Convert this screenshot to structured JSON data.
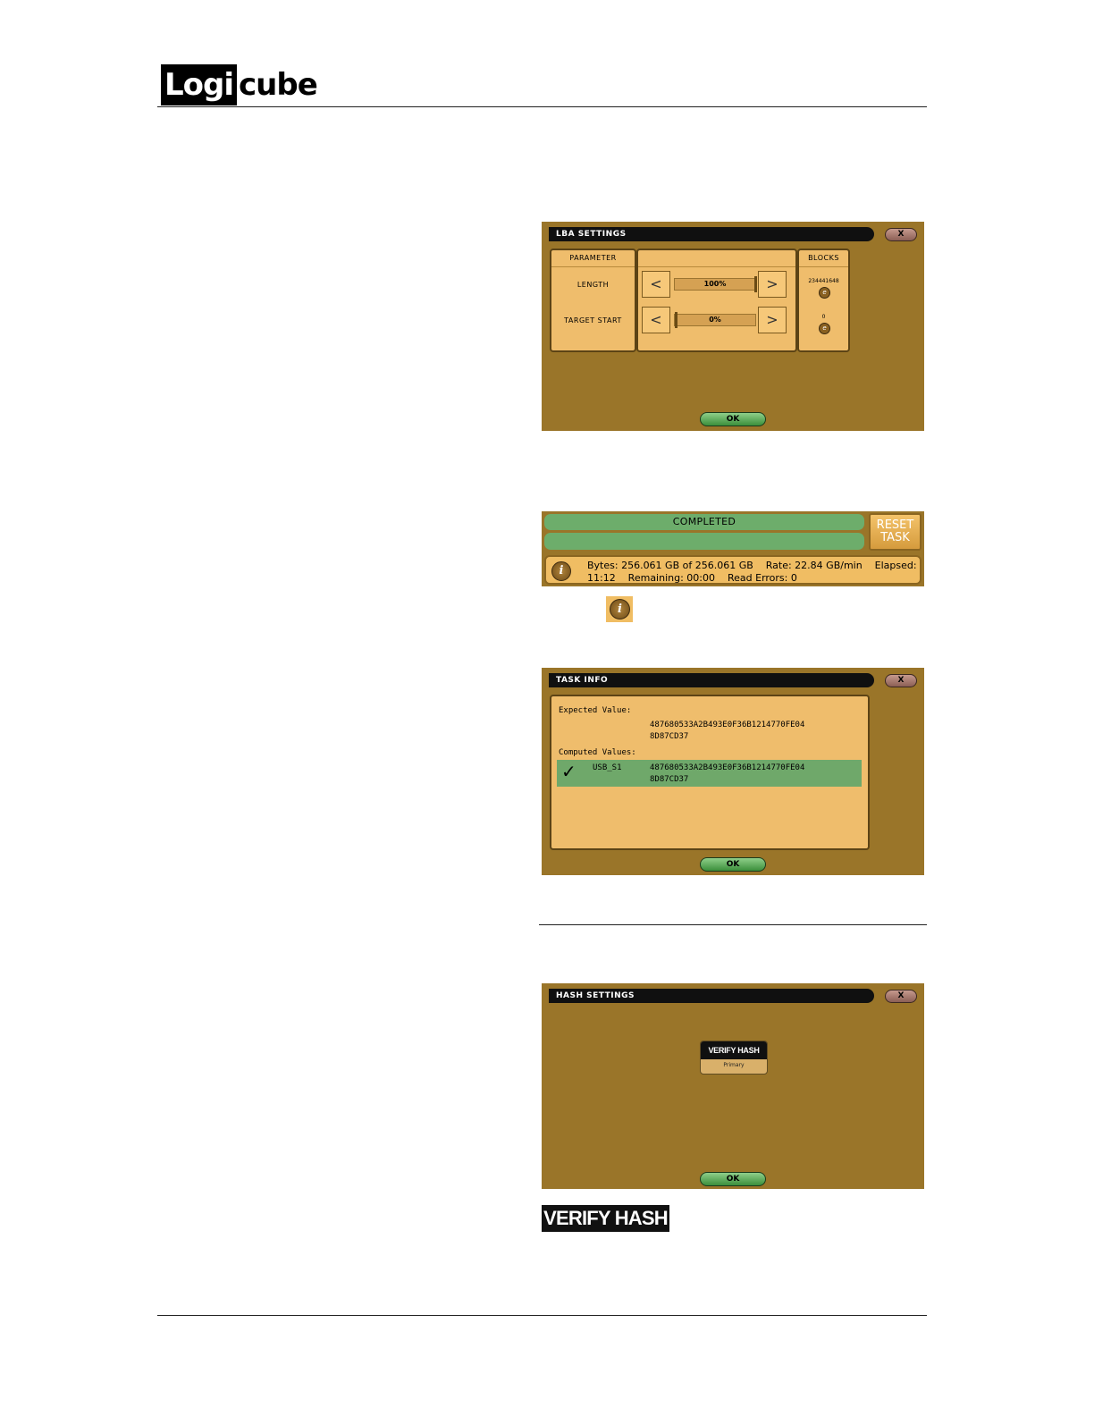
{
  "header": {
    "logo_part1": "Logi",
    "logo_part2": "cube"
  },
  "lba_settings": {
    "title": "LBA SETTINGS",
    "close_label": "X",
    "col_parameter": "PARAMETER",
    "col_blocks": "BLOCKS",
    "rows": [
      {
        "label": "LENGTH",
        "value": "100%",
        "blocks": "234441648"
      },
      {
        "label": "TARGET START",
        "value": "0%",
        "blocks": "0"
      }
    ],
    "ok_label": "OK"
  },
  "progress": {
    "status": "COMPLETED",
    "reset_line1": "RESET",
    "reset_line2": "TASK",
    "info_line1": "Bytes: 256.061 GB of 256.061 GB    Rate: 22.84 GB/min    Elapsed:",
    "info_line2": "11:12    Remaining: 00:00    Read Errors: 0",
    "info_icon_glyph": "i"
  },
  "inline_icon_glyph": "i",
  "task_info": {
    "title": "TASK INFO",
    "close_label": "X",
    "expected_label": "Expected Value:",
    "expected_line1": "487680533A2B493E0F36B1214770FE04",
    "expected_line2": "8D87CD37",
    "computed_label": "Computed Values:",
    "check_glyph": "✓",
    "device": "USB_S1",
    "computed_line1": "487680533A2B493E0F36B1214770FE04",
    "computed_line2": "8D87CD37",
    "ok_label": "OK"
  },
  "hash_settings": {
    "title": "HASH SETTINGS",
    "close_label": "X",
    "tile_title": "VERIFY HASH",
    "tile_sub": "Primary",
    "ok_label": "OK"
  },
  "verify_hash_label": "VERIFY HASH"
}
